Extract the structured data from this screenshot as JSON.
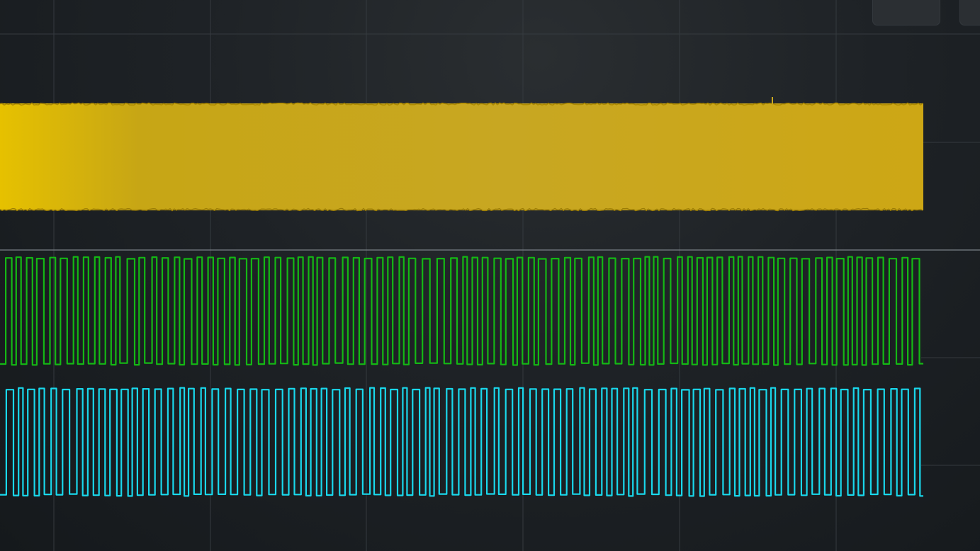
{
  "window": {
    "background": "#1e2226",
    "grid_color": "#3a4045",
    "divider_color": "#7a8086"
  },
  "toolbar": {
    "buttons": [
      {
        "icon": "refresh-circle-icon"
      },
      {
        "icon": "partial-button"
      }
    ]
  },
  "channels": [
    {
      "name": "",
      "color": "#d9b400",
      "style": "dense-fill"
    },
    {
      "name": "",
      "color": "#14b814",
      "style": "square-wave"
    },
    {
      "name": "",
      "color": "#19d8ec",
      "style": "square-wave"
    }
  ]
}
